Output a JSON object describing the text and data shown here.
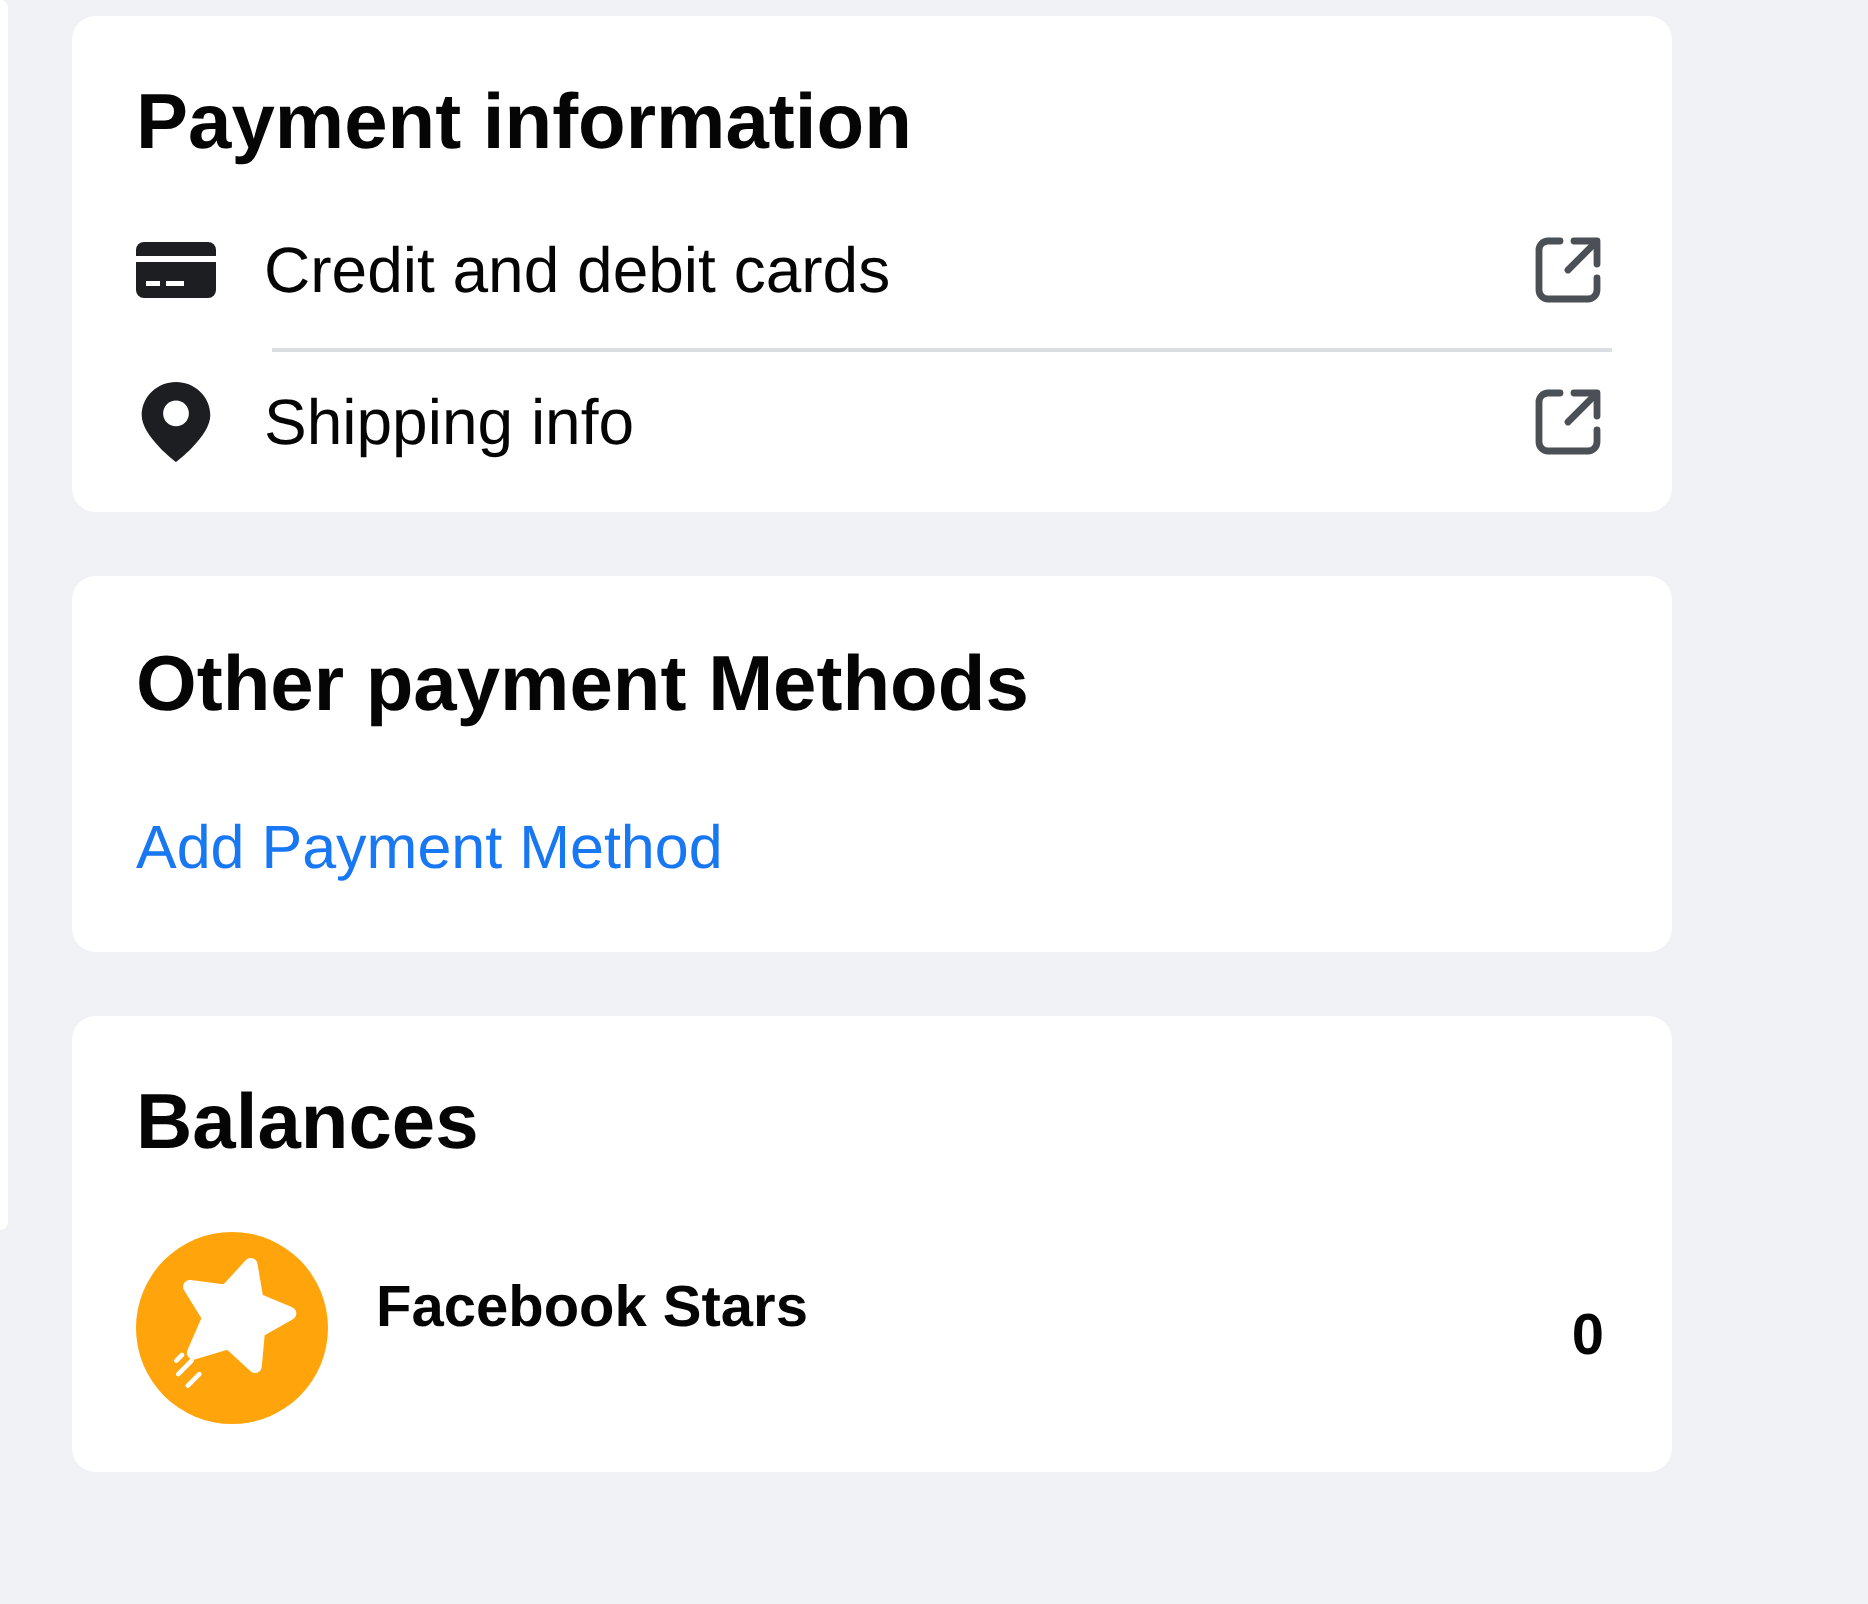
{
  "payment_information": {
    "title": "Payment information",
    "items": [
      {
        "label": "Credit and debit cards",
        "kind": "card"
      },
      {
        "label": "Shipping info",
        "kind": "location"
      }
    ]
  },
  "other_payment_methods": {
    "title": "Other payment Methods",
    "link": "Add Payment Method"
  },
  "balances": {
    "title": "Balances",
    "items": [
      {
        "name": "Facebook Stars",
        "amount": "0"
      }
    ]
  }
}
